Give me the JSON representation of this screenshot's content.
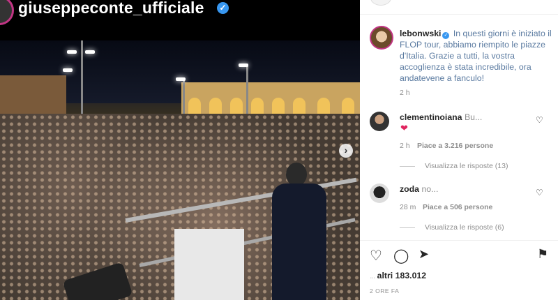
{
  "post_header": {
    "username": "giuseppeconte_ufficiale",
    "verified_icon": "verified-badge-icon"
  },
  "photo": {
    "next_icon": "chevron-right-icon"
  },
  "caption": {
    "username": "lebonwski",
    "text": "In questi giorni è iniziato il FLOP tour, abbiamo riempito le piazze d'Italia. Grazie a tutti, la vostra accoglienza è stata incredibile, ora andatevene a fanculo!",
    "time": "2 h"
  },
  "comments": [
    {
      "username": "clementinoiana",
      "text": "Bu...",
      "time": "2 h",
      "likes": "Piace a 3.216 persone",
      "replies": "Visualizza le risposte (13)",
      "heart": "❤"
    },
    {
      "username": "zoda",
      "text": "no...",
      "time": "28 m",
      "likes": "Piace a 506 persone",
      "replies": "Visualizza le risposte (6)"
    }
  ],
  "likes": {
    "blurred": "...",
    "text": "altri 183.012"
  },
  "post_time": "2 ORE FA",
  "colors": {
    "verified": "#3897f0",
    "text": "#262626",
    "meta": "#8e8e8e"
  }
}
